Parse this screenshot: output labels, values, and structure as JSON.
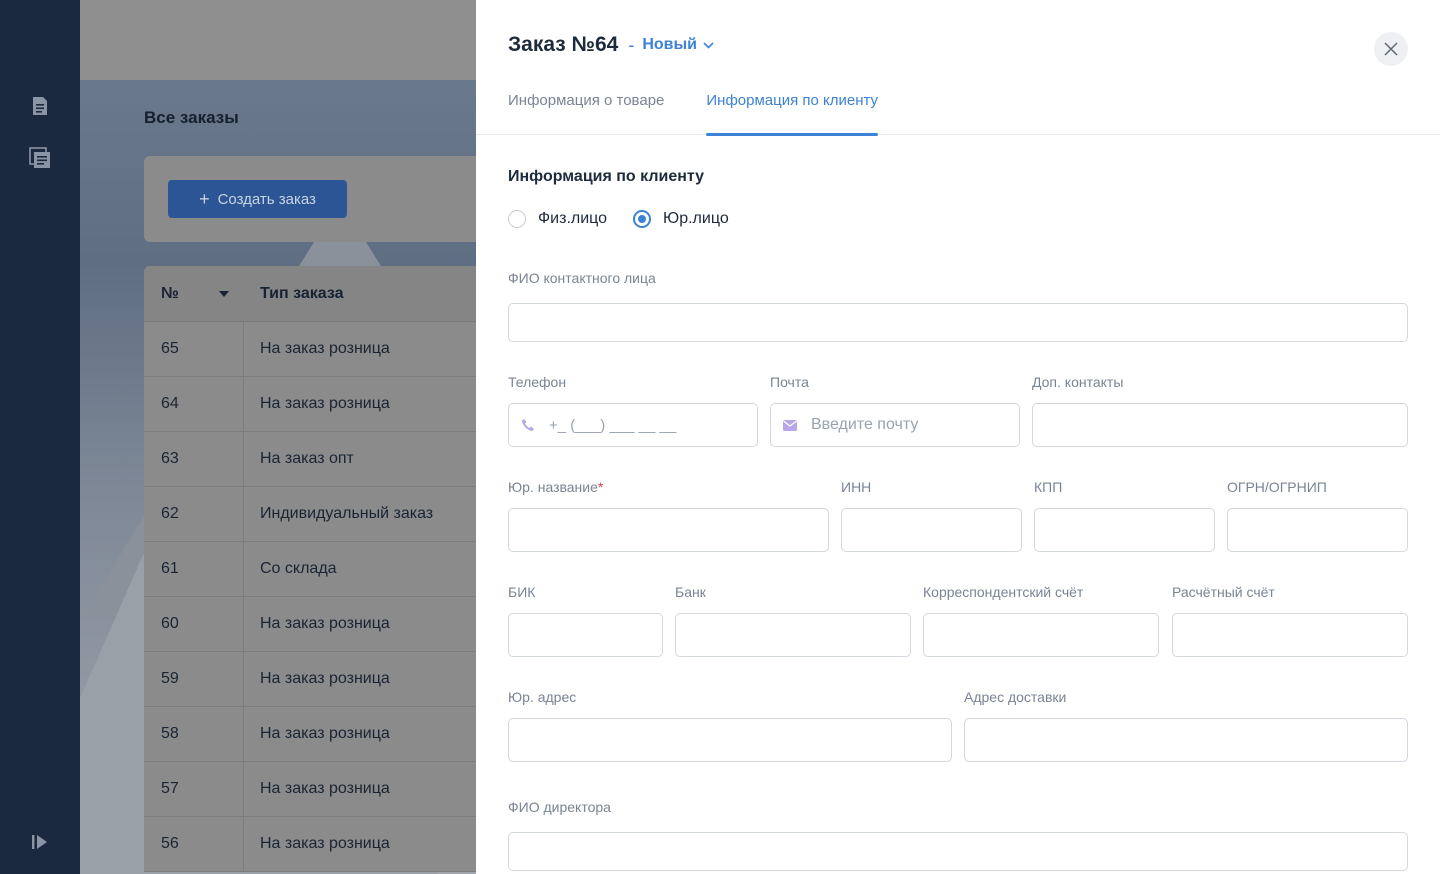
{
  "background": {
    "page_title": "Все заказы",
    "create_button": "Создать заказ",
    "table": {
      "col_num": "№",
      "col_type": "Тип заказа",
      "rows": [
        {
          "num": "65",
          "type": "На заказ розница"
        },
        {
          "num": "64",
          "type": "На заказ розница"
        },
        {
          "num": "63",
          "type": "На заказ опт"
        },
        {
          "num": "62",
          "type": "Индивидуальный заказ"
        },
        {
          "num": "61",
          "type": "Со склада"
        },
        {
          "num": "60",
          "type": "На заказ розница"
        },
        {
          "num": "59",
          "type": "На заказ розница"
        },
        {
          "num": "58",
          "type": "На заказ розница"
        },
        {
          "num": "57",
          "type": "На заказ розница"
        },
        {
          "num": "56",
          "type": "На заказ розница"
        }
      ]
    }
  },
  "drawer": {
    "title": "Заказ №64",
    "dash": "-",
    "status": "Новый",
    "tabs": [
      {
        "label": "Информация о товаре",
        "active": false
      },
      {
        "label": "Информация по клиенту",
        "active": true
      }
    ],
    "section_title": "Информация по клиенту",
    "client_types": [
      {
        "label": "Физ.лицо",
        "selected": false
      },
      {
        "label": "Юр.лицо",
        "selected": true
      }
    ],
    "fields": {
      "contact_name": {
        "label": "ФИО контактного лица",
        "value": ""
      },
      "phone": {
        "label": "Телефон",
        "placeholder": "+_ (___) ___ __ __"
      },
      "email": {
        "label": "Почта",
        "placeholder": "Введите почту"
      },
      "extra_contacts": {
        "label": "Доп. контакты",
        "value": ""
      },
      "legal_name": {
        "label": "Юр. название",
        "required_mark": "*",
        "value": ""
      },
      "inn": {
        "label": "ИНН",
        "value": ""
      },
      "kpp": {
        "label": "КПП",
        "value": ""
      },
      "ogrn": {
        "label": "ОГРН/ОГРНИП",
        "value": ""
      },
      "bik": {
        "label": "БИК",
        "value": ""
      },
      "bank": {
        "label": "Банк",
        "value": ""
      },
      "corr_account": {
        "label": "Корреспондентский счёт",
        "value": ""
      },
      "settlement_account": {
        "label": "Расчётный счёт",
        "value": ""
      },
      "legal_address": {
        "label": "Юр. адрес",
        "value": ""
      },
      "delivery_address": {
        "label": "Адрес доставки",
        "value": ""
      },
      "director_name": {
        "label": "ФИО директора",
        "value": ""
      }
    }
  },
  "colors": {
    "accent": "#3c82d6",
    "sidebar": "#1b2940",
    "required": "#d43c3c"
  }
}
